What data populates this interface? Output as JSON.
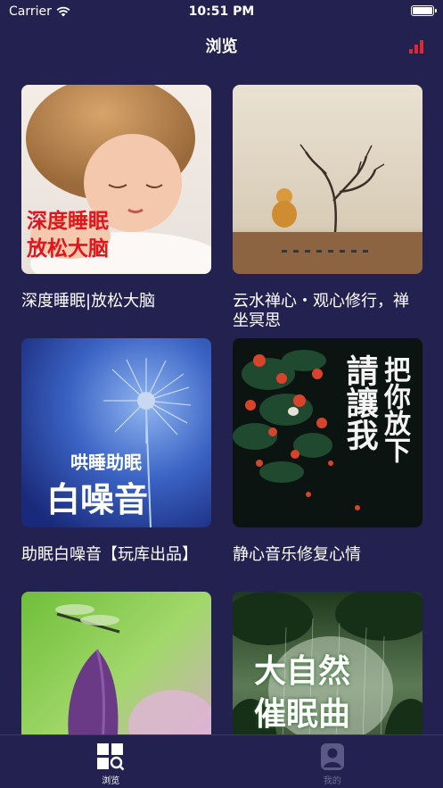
{
  "status_bar": {
    "carrier": "Carrier",
    "time": "10:51 PM"
  },
  "nav": {
    "title": "浏览",
    "right_icon": "signal-bars-icon",
    "accent": "#e6262d"
  },
  "cards": [
    {
      "title": "深度睡眠|放松大脑",
      "overlay": [
        "深度睡眠",
        "放松大脑"
      ]
    },
    {
      "title": "云水禅心・观心修行，禅坐冥思",
      "overlay": []
    },
    {
      "title": "助眠白噪音【玩库出品】",
      "overlay": [
        "哄睡助眠",
        "白噪音"
      ]
    },
    {
      "title": "静心音乐修复心情",
      "overlay": [
        "把你放下",
        "請讓我"
      ]
    },
    {
      "title": "",
      "overlay": []
    },
    {
      "title": "",
      "overlay": [
        "大自然",
        "催眠曲"
      ]
    }
  ],
  "tabs": [
    {
      "label": "浏览",
      "icon": "browse-grid-icon",
      "active": true
    },
    {
      "label": "我的",
      "icon": "profile-icon",
      "active": false
    }
  ],
  "colors": {
    "background": "#23214f",
    "tab_inactive": "#6f6d93"
  }
}
